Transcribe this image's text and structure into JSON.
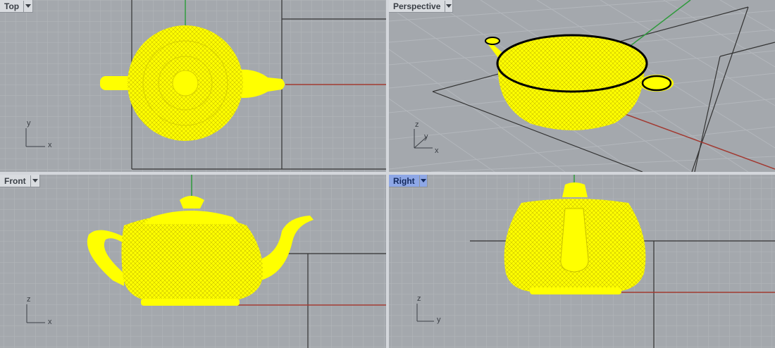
{
  "viewports": {
    "top": {
      "label": "Top",
      "axis": {
        "v": "y",
        "h": "x"
      }
    },
    "perspective": {
      "label": "Perspective",
      "axis": {
        "v": "z",
        "d": "y",
        "h": "x"
      }
    },
    "front": {
      "label": "Front",
      "axis": {
        "v": "z",
        "h": "x"
      }
    },
    "right": {
      "label": "Right",
      "axis": {
        "v": "z",
        "h": "y"
      }
    }
  },
  "colors": {
    "viewport_bg": "#a4a8ad",
    "grid_minor": "#b3b7bc",
    "grid_major": "#8a8e94",
    "axis_x": "#a23a32",
    "axis_y": "#2f9a3c",
    "object_wire": "#ffff00",
    "selection_edge": "#000000",
    "active_tab": "#8ea7e6"
  },
  "icons": [
    "dropdown-arrow-icon",
    "axis-indicator-icon"
  ]
}
